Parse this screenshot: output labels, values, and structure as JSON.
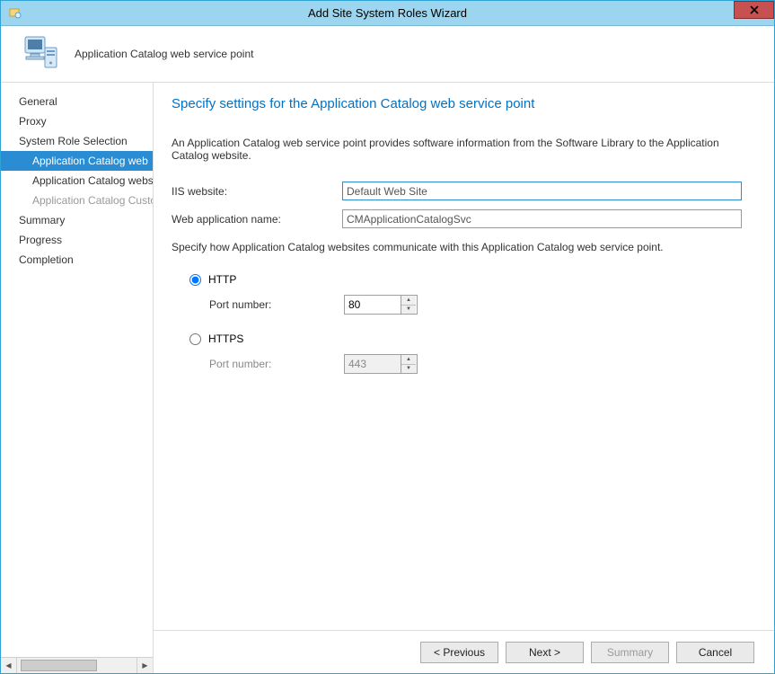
{
  "window": {
    "title": "Add Site System Roles Wizard"
  },
  "header": {
    "subtitle": "Application Catalog web service point"
  },
  "sidebar": {
    "items": [
      {
        "label": "General",
        "level": 1,
        "state": "normal"
      },
      {
        "label": "Proxy",
        "level": 1,
        "state": "normal"
      },
      {
        "label": "System Role Selection",
        "level": 1,
        "state": "normal"
      },
      {
        "label": "Application Catalog web",
        "level": 2,
        "state": "selected"
      },
      {
        "label": "Application Catalog website point",
        "level": 2,
        "state": "normal"
      },
      {
        "label": "Application Catalog Customizations",
        "level": 2,
        "state": "disabled"
      },
      {
        "label": "Summary",
        "level": 1,
        "state": "normal"
      },
      {
        "label": "Progress",
        "level": 1,
        "state": "normal"
      },
      {
        "label": "Completion",
        "level": 1,
        "state": "normal"
      }
    ]
  },
  "page": {
    "title": "Specify settings for the Application Catalog web service point",
    "desc": "An Application Catalog web service point provides software information from the Software Library to the Application Catalog website.",
    "iis_label": "IIS website:",
    "iis_value": "Default Web Site",
    "webapp_label": "Web application name:",
    "webapp_value": "CMApplicationCatalogSvc",
    "comm_desc": "Specify how Application Catalog websites communicate with this Application Catalog web service point.",
    "http_label": "HTTP",
    "https_label": "HTTPS",
    "port_label": "Port number:",
    "http_port": "80",
    "https_port": "443"
  },
  "footer": {
    "previous": "< Previous",
    "next": "Next >",
    "summary": "Summary",
    "cancel": "Cancel"
  }
}
